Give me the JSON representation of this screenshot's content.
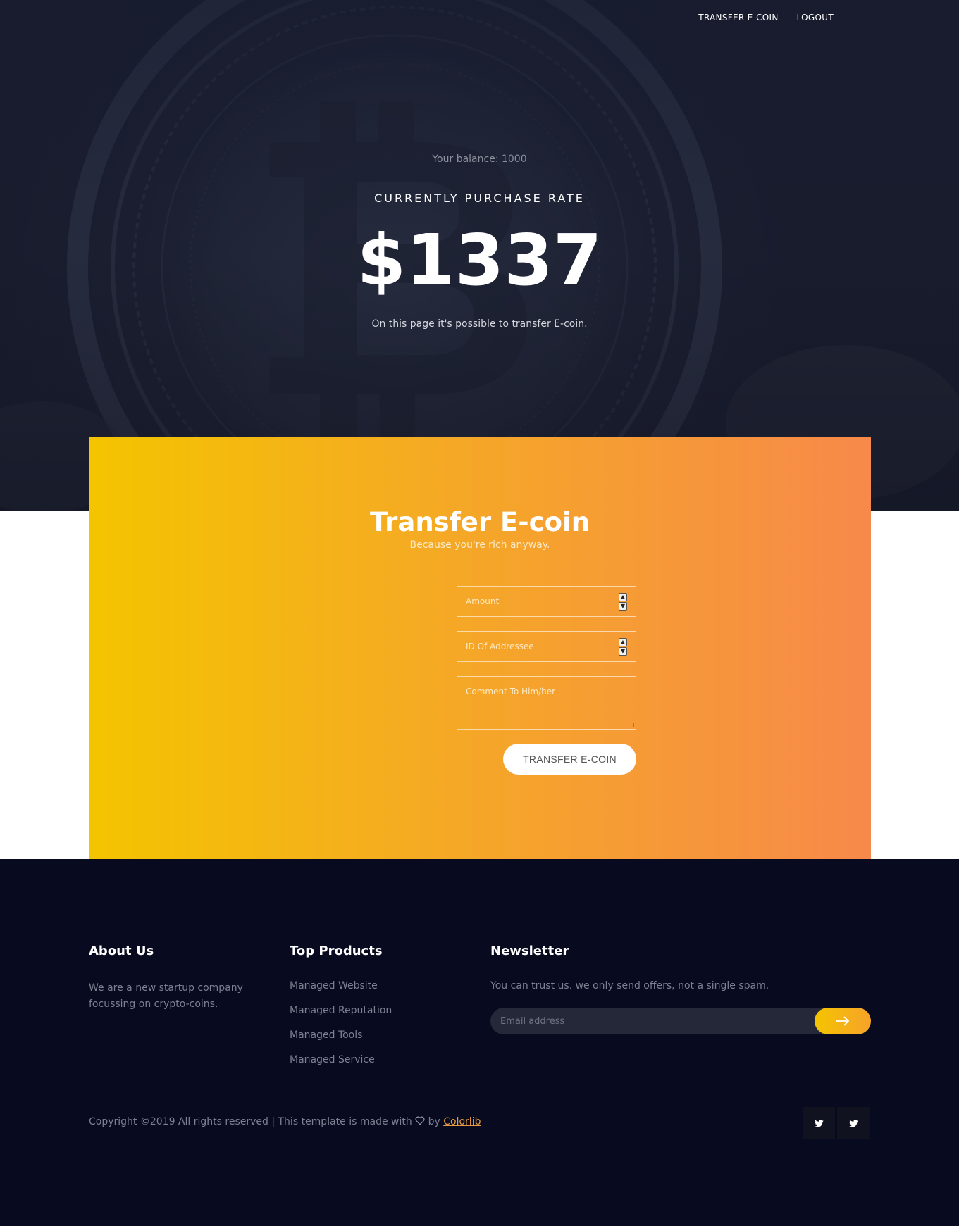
{
  "nav": {
    "transfer_label": "TRANSFER E-COIN",
    "logout_label": "LOGOUT"
  },
  "hero": {
    "balance": "Your balance: 1000",
    "rate_label": "CURRENTLY PURCHASE RATE",
    "rate_value": "$1337",
    "description": "On this page it's possible to transfer E-coin."
  },
  "transfer": {
    "title": "Transfer E-coin",
    "subtitle": "Because you're rich anyway.",
    "amount_placeholder": "Amount",
    "addressee_placeholder": "ID Of Addressee",
    "comment_placeholder": "Comment To Him/her",
    "submit_label": "TRANSFER E-COIN"
  },
  "footer": {
    "about": {
      "title": "About Us",
      "text": "We are a new startup company focussing on crypto-coins."
    },
    "products": {
      "title": "Top Products",
      "items": [
        "Managed Website",
        "Managed Reputation",
        "Managed Tools",
        "Managed Service"
      ]
    },
    "newsletter": {
      "title": "Newsletter",
      "text": "You can trust us. we only send offers, not a single spam.",
      "email_placeholder": "Email address",
      "submit_icon": "arrow-right-icon"
    },
    "copyright_prefix": "Copyright ©2019 All rights reserved | This template is made with",
    "copyright_by": "by",
    "copyright_brand": "Colorlib",
    "social_icons": [
      "twitter-icon",
      "twitter-icon"
    ]
  },
  "colors": {
    "hero_bg": "#1c2031",
    "gradient_start": "#f4c400",
    "gradient_end": "#f7894a",
    "footer_bg": "#080b1f",
    "brand_link": "#e79a44"
  }
}
